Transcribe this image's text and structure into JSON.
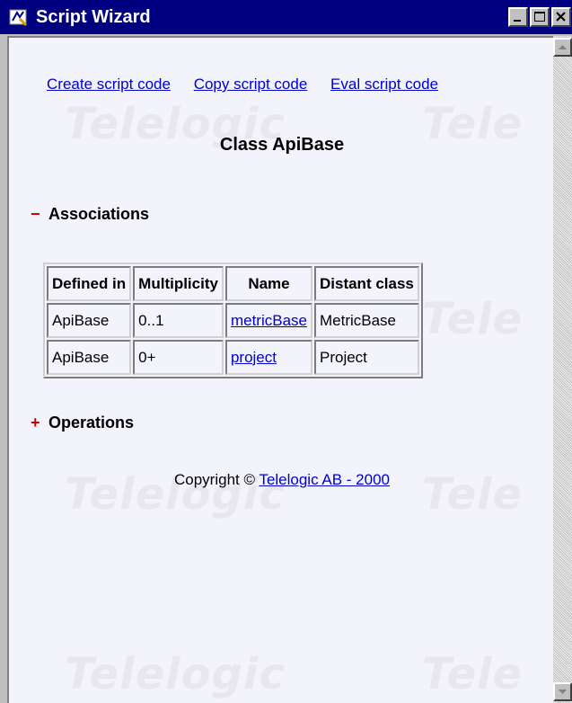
{
  "window": {
    "title": "Script Wizard"
  },
  "links": {
    "create": "Create script code",
    "copy": "Copy script code",
    "eval": "Eval script code"
  },
  "class_title": "Class ApiBase",
  "associations": {
    "toggle": "−",
    "label": "Associations",
    "headers": [
      "Defined in",
      "Multiplicity",
      "Name",
      "Distant class"
    ],
    "rows": [
      [
        "ApiBase",
        "0..1",
        "metricBase",
        "MetricBase"
      ],
      [
        "ApiBase",
        "0+",
        "project",
        "Project"
      ]
    ]
  },
  "operations": {
    "toggle": "+",
    "label": "Operations"
  },
  "footer": {
    "prefix": "Copyright ©",
    "link": "Telelogic AB - 2000"
  },
  "watermark": {
    "text": "Telelogic",
    "partial": "Tele"
  },
  "colors": {
    "titlebar": "#000080",
    "link": "#0000cc",
    "toggle": "#cc0000"
  }
}
